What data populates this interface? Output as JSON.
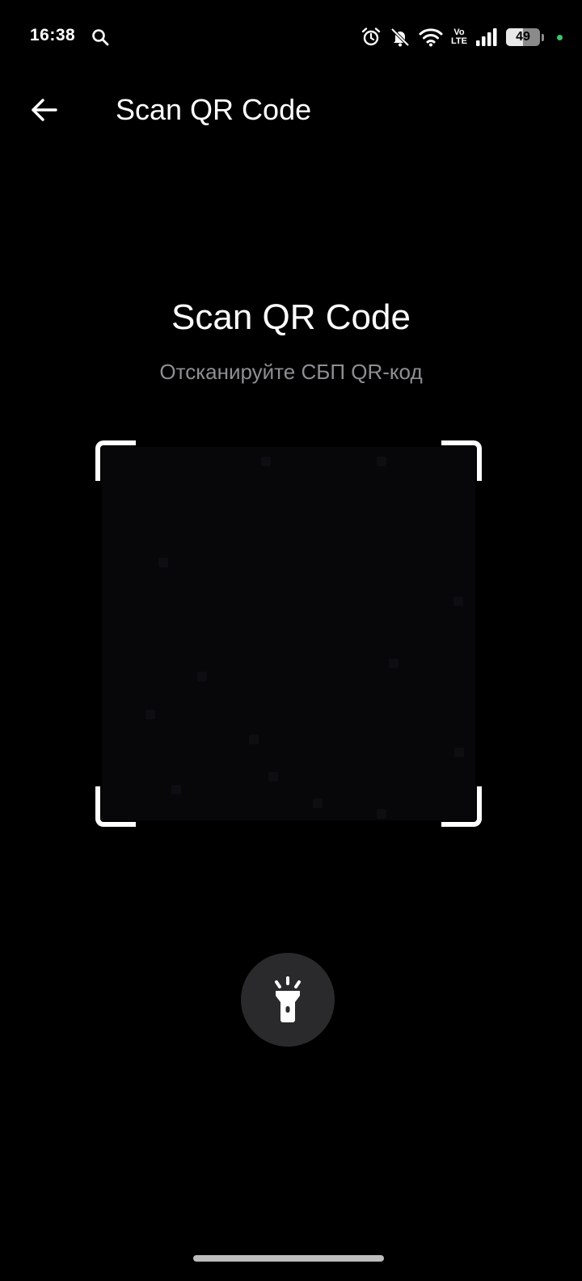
{
  "status_bar": {
    "time": "16:38",
    "network_top": "Vo",
    "network_bottom": "LTE",
    "battery_level": "49",
    "battery_fraction": 0.49,
    "icons": [
      "search-icon",
      "alarm-icon",
      "bell-muted-icon",
      "wifi-icon",
      "signal-icon",
      "battery-icon"
    ]
  },
  "app_bar": {
    "title": "Scan QR Code",
    "back_icon": "arrow-left-icon"
  },
  "main": {
    "heading": "Scan QR Code",
    "subtitle": "Отсканируйте СБП QR-код"
  },
  "controls": {
    "flashlight_icon": "flashlight-icon"
  },
  "colors": {
    "background": "#000000",
    "text_primary": "#ffffff",
    "text_secondary": "#8e8e93",
    "button_bg": "#2a2a2c",
    "charging_dot": "#3ec46d"
  }
}
